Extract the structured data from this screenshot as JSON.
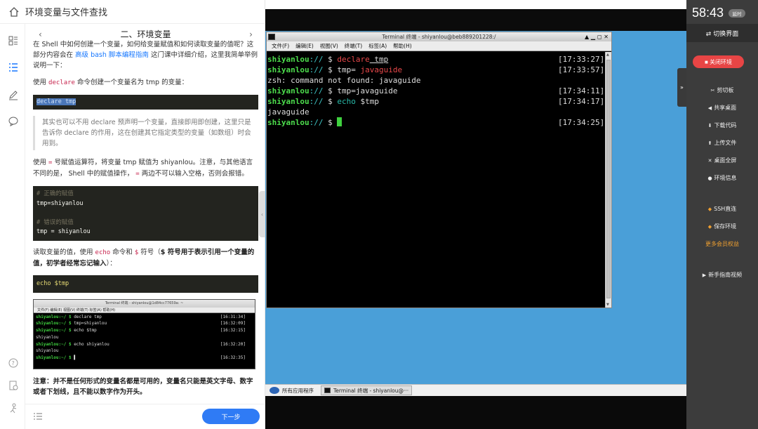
{
  "doc": {
    "title": "环境变量与文件查找",
    "section_title": "二、环境变量",
    "prev_label": "‹",
    "next_label": "›",
    "intro_1": "在 Shell 中如何创建一个变量，如何给变量赋值和如何读取变量的值呢？这部分内容会在",
    "intro_link": "高级 bash 脚本编程指南",
    "intro_2": "这门课中详细介绍，这里我简单举例说明一下：",
    "use_1": "使用",
    "use_kw": "declare",
    "use_2": "命令创建一个变量名为 tmp 的变量：",
    "code1": "declare tmp",
    "quote": "其实也可以不用 declare 预声明一个变量，直接即用即创建，这里只是告诉你 declare 的作用，这在创建其它指定类型的变量（如数组）时会用到。",
    "assign_1": "使用",
    "assign_kw1": "=",
    "assign_2": "号赋值运算符，将变量 tmp 赋值为 shiyanlou。注意，与其他语言不同的是， Shell 中的赋值操作，",
    "assign_kw2": "=",
    "assign_3": "两边不可以输入空格，否则会报错。",
    "code2_c1": "# 正确的赋值",
    "code2_l1": "tmp=shiyanlou",
    "code2_c2": "# 错误的赋值",
    "code2_l2": "tmp = shiyanlou",
    "read_1": "读取变量的值，使用",
    "read_kw1": "echo",
    "read_2": "命令和",
    "read_kw2": "$",
    "read_3": "符号（",
    "read_bold": "$ 符号用于表示引用一个变量的值，初学者经常忘记输入",
    "read_4": "）：",
    "code3": "echo $tmp",
    "mini_term": {
      "title": "Terminal 终端 - shiyanlou@1d84cc77659a: ~",
      "menu": "文件(F)   编辑(E)   视图(V)   终端(T)   标签(A)   帮助(H)",
      "lines": [
        {
          "user": "shiyanlou:~/ $ ",
          "cmd": "declare tmp",
          "time": "[16:31:34]"
        },
        {
          "user": "shiyanlou:~/ $ ",
          "cmd": "tmp=shiyanlou",
          "time": "[16:32:09]"
        },
        {
          "user": "shiyanlou:~/ $ ",
          "cmd": "echo $tmp",
          "time": "[16:32:15]"
        },
        {
          "user": "",
          "cmd": "shiyanlou",
          "time": ""
        },
        {
          "user": "shiyanlou:~/ $ ",
          "cmd": "echo shiyanlou",
          "time": "[16:32:20]"
        },
        {
          "user": "",
          "cmd": "shiyanlou",
          "time": ""
        },
        {
          "user": "shiyanlou:~/ $ ",
          "cmd": "▌",
          "time": "[16:32:35]"
        }
      ]
    },
    "note": "注意：并不是任何形式的变量名都是可用的，变量名只能是英文字母、数字或者下划线，且不能以数字作为开头。",
    "next_button": "下一步"
  },
  "terminal": {
    "title": "Terminal 终端 - shiyanlou@beb889201228:/",
    "controls": "▲ ▁ ◻ ✕",
    "menu": [
      "文件(F)",
      "编辑(E)",
      "视图(V)",
      "终端(T)",
      "标签(A)",
      "帮助(H)"
    ],
    "lines": [
      {
        "user": "shiyanlou",
        "path": ":// ",
        "prompt": "$ ",
        "cmd_a": "declare",
        "cmd_b": " tmp",
        "time": "[17:33:27]"
      },
      {
        "user": "shiyanlou",
        "path": ":// ",
        "prompt": "$ ",
        "cmd_a": "tmp= ",
        "cmd_b": "javaguide",
        "time": "[17:33:57]"
      },
      {
        "text": "zsh: command not found: javaguide"
      },
      {
        "user": "shiyanlou",
        "path": ":// ",
        "prompt": "$ ",
        "cmd_a": "tmp=javaguide",
        "cmd_b": "",
        "time": "[17:34:11]"
      },
      {
        "user": "shiyanlou",
        "path": ":// ",
        "prompt": "$ ",
        "cmd_a": "echo",
        "cmd_b": " $tmp",
        "time": "[17:34:17]"
      },
      {
        "text": "javaguide"
      },
      {
        "user": "shiyanlou",
        "path": ":// ",
        "prompt": "$ ",
        "cmd_a": "",
        "cmd_b": "",
        "time": "[17:34:25]"
      }
    ]
  },
  "taskbar": {
    "apps_label": "所有应用程序",
    "window_label": "Terminal 终端 - shiyanlou@···"
  },
  "panel": {
    "clock": "58:43",
    "extend": "延时",
    "switch": "⇄ 切换界面",
    "close_env": "■ 关闭环境",
    "items": [
      "剪切板",
      "共享桌面",
      "下载代码",
      "上传文件",
      "桌面全屏",
      "环境信息"
    ],
    "ssh": "SSH直连",
    "save_env": "保存环境",
    "more": "更多会员权益",
    "guide": "新手指南视频"
  },
  "colors": {
    "accent": "#2f7bf5",
    "danger": "#e84545",
    "desktop": "#4a9fd8",
    "prompt": "#4dde4d"
  }
}
